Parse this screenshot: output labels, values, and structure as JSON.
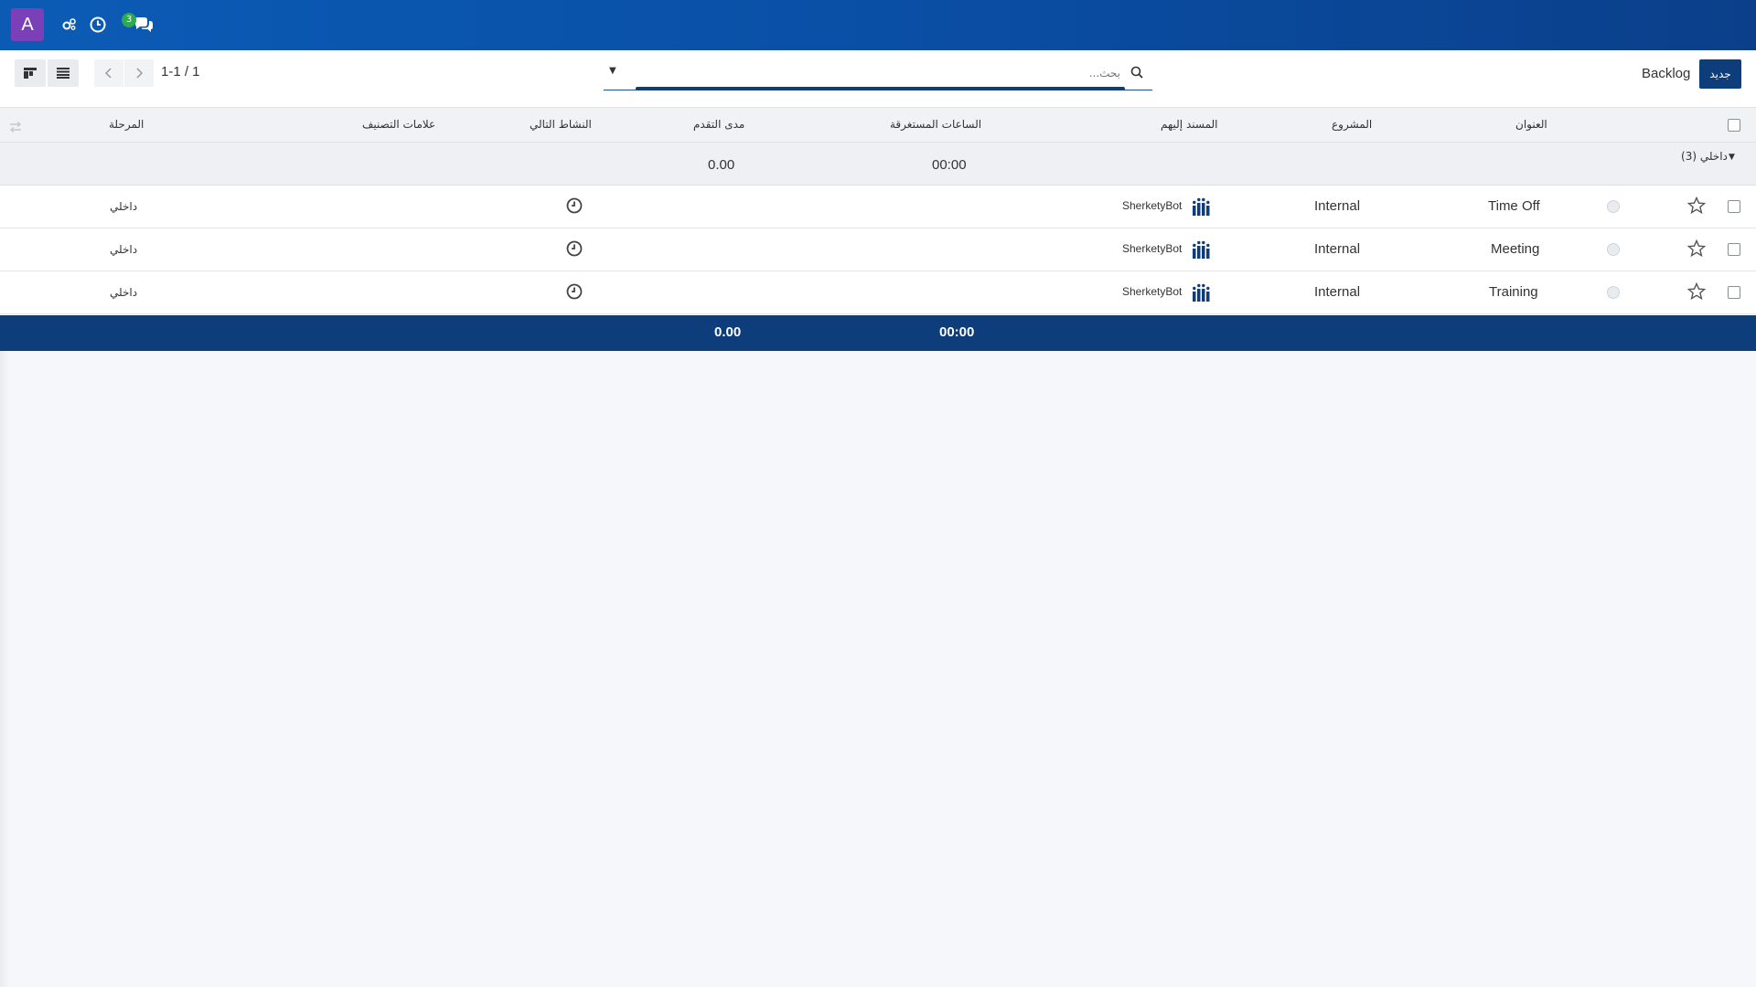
{
  "topbar": {
    "avatar_letter": "A",
    "icons": [
      "gears-icon",
      "clock-icon",
      "chat-icon"
    ],
    "chat_badge": "3",
    "bg_color": "#0b4fa6"
  },
  "control": {
    "breadcrumb": "Backlog",
    "new_label": "جديد",
    "search_placeholder": "بحث...",
    "pager": "1-1 / 1"
  },
  "table": {
    "headers": {
      "title": "العنوان",
      "project": "المشروع",
      "assignee": "المسند إليهم",
      "hours_spent": "الساعات المستغرقة",
      "progress": "مدى التقدم",
      "next_activity": "النشاط التالي",
      "tags": "علامات التصنيف",
      "stage": "المرحلة"
    },
    "group": {
      "label": "داخلي (3)",
      "hours": "00:00",
      "progress": "0.00"
    },
    "rows": [
      {
        "title": "Time Off",
        "project": "Internal",
        "assignee": "SherketyBot",
        "stage": "داخلي"
      },
      {
        "title": "Meeting",
        "project": "Internal",
        "assignee": "SherketyBot",
        "stage": "داخلي"
      },
      {
        "title": "Training",
        "project": "Internal",
        "assignee": "SherketyBot",
        "stage": "داخلي"
      }
    ],
    "totals": {
      "hours": "00:00",
      "progress": "0.00"
    }
  }
}
